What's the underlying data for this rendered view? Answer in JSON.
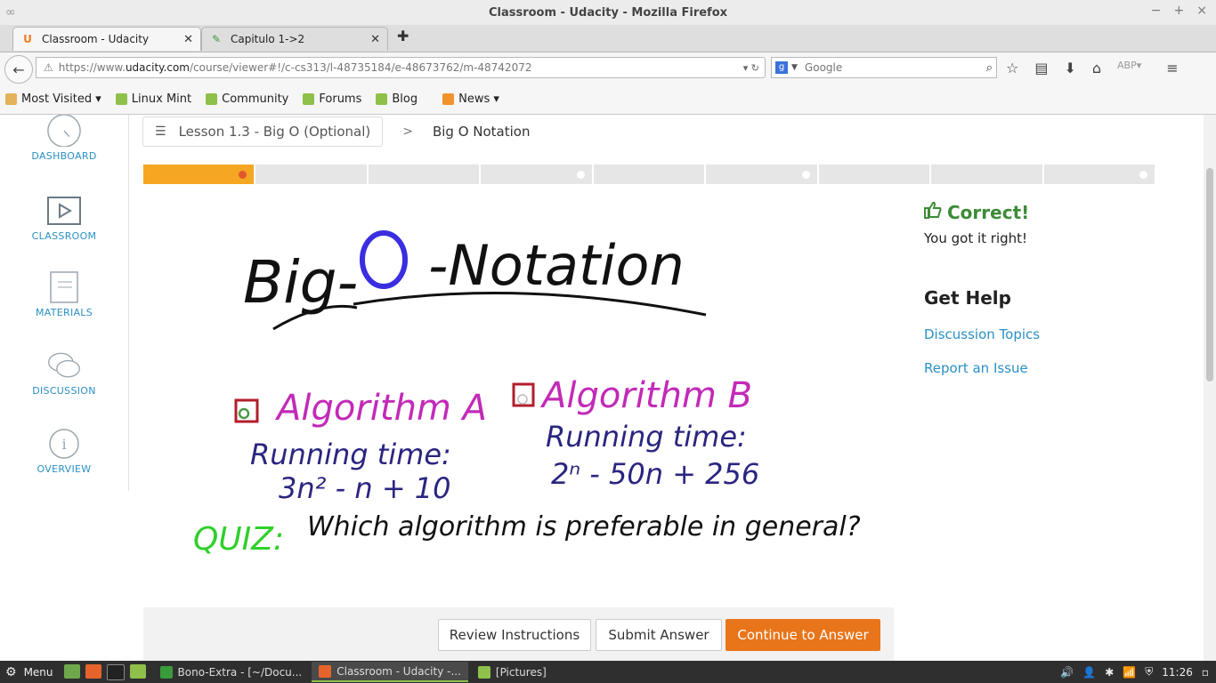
{
  "window": {
    "title": "Classroom - Udacity - Mozilla Firefox"
  },
  "tabs": [
    {
      "label": "Classroom - Udacity",
      "icon": "udacity-icon"
    },
    {
      "label": "Capitulo 1->2",
      "icon": "edit-icon"
    }
  ],
  "navbar": {
    "url_prefix": "https://www.",
    "url_domain": "udacity.com",
    "url_rest": "/course/viewer#!/c-cs313/l-48735184/e-48673762/m-48742072",
    "search_placeholder": "Google"
  },
  "bookmarks": [
    {
      "label": "Most Visited",
      "icon": "folder",
      "dropdown": true
    },
    {
      "label": "Linux Mint",
      "icon": "mint"
    },
    {
      "label": "Community",
      "icon": "mint"
    },
    {
      "label": "Forums",
      "icon": "mint"
    },
    {
      "label": "Blog",
      "icon": "mint"
    },
    {
      "label": "News",
      "icon": "rss",
      "dropdown": true
    }
  ],
  "sidenav": {
    "dashboard": "DASHBOARD",
    "classroom": "CLASSROOM",
    "materials": "MATERIALS",
    "discussion": "DISCUSSION",
    "overview": "OVERVIEW"
  },
  "breadcrumb": {
    "lesson": "Lesson 1.3 - Big O (Optional)",
    "separator": ">",
    "current": "Big O Notation"
  },
  "progress": {
    "segments": 9,
    "completed": 1
  },
  "whiteboard": {
    "title_left": "Big-",
    "title_o": "O",
    "title_right": "-Notation",
    "algo_a": "Algorithm A",
    "algo_b": "Algorithm B",
    "running_time_a": "Running time:",
    "running_time_b": "Running time:",
    "formula_a": "3n² - n + 10",
    "formula_b": "2ⁿ - 50n + 256",
    "quiz_label": "QUIZ:",
    "quiz_question": "Which algorithm is preferable in general?"
  },
  "controls": {
    "review": "Review Instructions",
    "submit": "Submit Answer",
    "continue": "Continue to Answer"
  },
  "feedback": {
    "status": "Correct!",
    "message": "You got it right!",
    "help_heading": "Get Help",
    "discussion_link": "Discussion Topics",
    "report_link": "Report an Issue"
  },
  "taskbar": {
    "menu": "Menu",
    "windows": [
      {
        "label": "Bono-Extra - [~/Docu...",
        "active": false
      },
      {
        "label": "Classroom - Udacity -...",
        "active": true
      },
      {
        "label": "[Pictures]",
        "active": false
      }
    ],
    "clock": "11:26"
  },
  "colors": {
    "accent_orange": "#e8751a",
    "progress_orange": "#f5a623",
    "link_blue": "#2a90c4",
    "correct_green": "#3d8b37"
  }
}
